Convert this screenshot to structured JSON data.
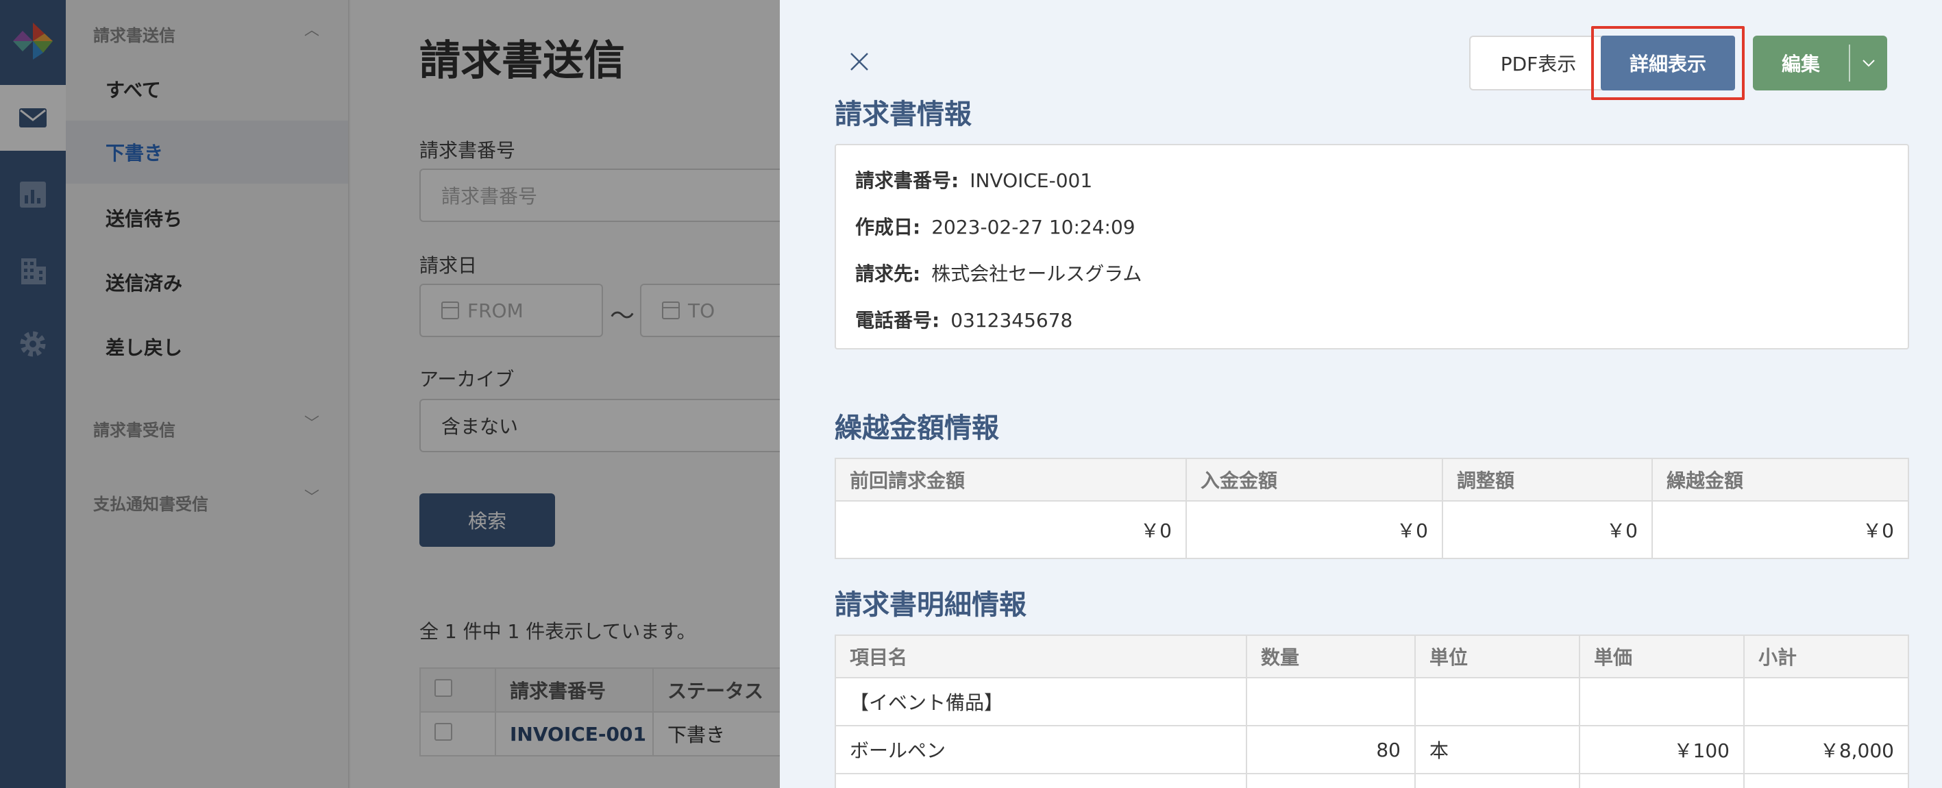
{
  "colors": {
    "primary": "#3f5a80",
    "accent_link": "#2f6fc6",
    "edit_green": "#6a9a70",
    "highlight_red": "#e0392b"
  },
  "rail": {
    "icons": [
      "logo-icon",
      "mail-icon",
      "bar-chart-icon",
      "building-icon",
      "gear-icon"
    ]
  },
  "sidebar": {
    "section_send": "請求書送信",
    "items": [
      {
        "label": "すべて"
      },
      {
        "label": "下書き"
      },
      {
        "label": "送信待ち"
      },
      {
        "label": "送信済み"
      },
      {
        "label": "差し戻し"
      }
    ],
    "section_receive": "請求書受信",
    "section_payment": "支払通知書受信"
  },
  "main": {
    "title": "請求書送信",
    "invoice_number_label": "請求書番号",
    "invoice_number_placeholder": "請求書番号",
    "invoice_date_label": "請求日",
    "date_from": "FROM",
    "date_separator": "〜",
    "date_to": "TO",
    "archive_label": "アーカイブ",
    "archive_value": "含まない",
    "search_button": "検索",
    "count_text": "全 1 件中 1 件表示しています。",
    "table": {
      "headers": [
        "請求書番号",
        "ステータス"
      ],
      "rows": [
        {
          "invoice_no": "INVOICE-001",
          "status": "下書き"
        }
      ]
    }
  },
  "drawer": {
    "pdf_button": "PDF表示",
    "detail_button": "詳細表示",
    "edit_button": "編集",
    "invoice_info": {
      "title": "請求書情報",
      "fields": [
        {
          "label": "請求書番号:",
          "value": "INVOICE-001"
        },
        {
          "label": "作成日:",
          "value": "2023-02-27 10:24:09"
        },
        {
          "label": "請求先:",
          "value": "株式会社セールスグラム"
        },
        {
          "label": "電話番号:",
          "value": "0312345678"
        }
      ]
    },
    "carryover": {
      "title": "繰越金額情報",
      "headers": [
        "前回請求金額",
        "入金金額",
        "調整額",
        "繰越金額"
      ],
      "values": [
        "￥0",
        "￥0",
        "￥0",
        "￥0"
      ]
    },
    "details": {
      "title": "請求書明細情報",
      "headers": [
        "項目名",
        "数量",
        "単位",
        "単価",
        "小計"
      ],
      "rows": [
        {
          "item": "【イベント備品】",
          "qty": "",
          "unit": "",
          "price": "",
          "subtotal": ""
        },
        {
          "item": "ボールペン",
          "qty": "80",
          "unit": "本",
          "price": "￥100",
          "subtotal": "￥8,000"
        }
      ]
    }
  }
}
